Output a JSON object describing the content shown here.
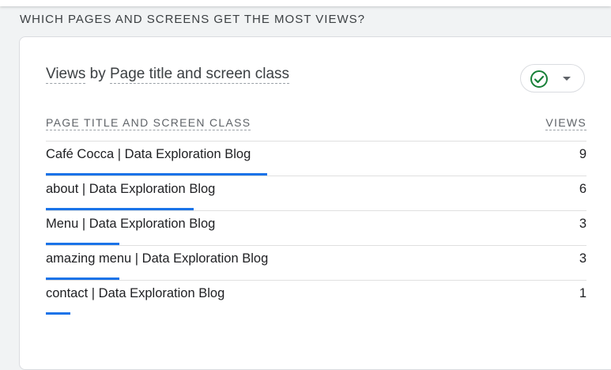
{
  "section": {
    "heading": "WHICH PAGES AND SCREENS GET THE MOST VIEWS?"
  },
  "card": {
    "title_metric": "Views",
    "title_by": "by",
    "title_dimension": "Page title and screen class",
    "compare_icon": "check-circle-icon",
    "dropdown_icon": "caret-down-icon",
    "accent_color": "#1a73e8",
    "check_color": "#188038"
  },
  "table": {
    "columns": [
      "PAGE TITLE AND SCREEN CLASS",
      "VIEWS"
    ],
    "max_value": 9,
    "rows": [
      {
        "label": "Café Cocca | Data Exploration Blog",
        "value": "9",
        "fraction": 1.0
      },
      {
        "label": "about | Data Exploration Blog",
        "value": "6",
        "fraction": 0.667
      },
      {
        "label": "Menu | Data Exploration Blog",
        "value": "3",
        "fraction": 0.333
      },
      {
        "label": "amazing menu | Data Exploration Blog",
        "value": "3",
        "fraction": 0.333
      },
      {
        "label": "contact | Data Exploration Blog",
        "value": "1",
        "fraction": 0.111
      }
    ]
  }
}
